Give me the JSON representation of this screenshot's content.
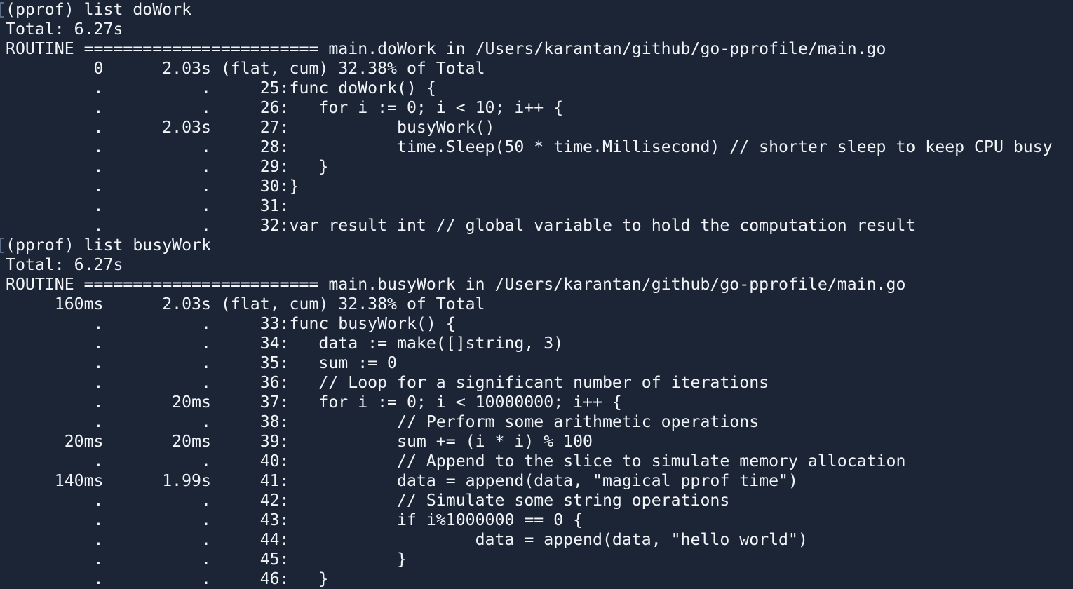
{
  "terminal": {
    "background": "#1b2536",
    "foreground": "#f2f4f8",
    "lines": [
      {
        "text": "(pprof) list doWork",
        "prompt": true
      },
      {
        "text": "Total: 6.27s"
      },
      {
        "text": "ROUTINE ======================== main.doWork in /Users/karantan/github/go-pprofile/main.go"
      },
      {
        "text": "         0      2.03s (flat, cum) 32.38% of Total"
      },
      {
        "text": "         .          .     25:func doWork() {"
      },
      {
        "text": "         .          .     26:   for i := 0; i < 10; i++ {"
      },
      {
        "text": "         .      2.03s     27:           busyWork()"
      },
      {
        "text": "         .          .     28:           time.Sleep(50 * time.Millisecond) // shorter sleep to keep CPU busy"
      },
      {
        "text": "         .          .     29:   }"
      },
      {
        "text": "         .          .     30:}"
      },
      {
        "text": "         .          .     31:"
      },
      {
        "text": "         .          .     32:var result int // global variable to hold the computation result"
      },
      {
        "text": "(pprof) list busyWork",
        "prompt": true
      },
      {
        "text": "Total: 6.27s"
      },
      {
        "text": "ROUTINE ======================== main.busyWork in /Users/karantan/github/go-pprofile/main.go"
      },
      {
        "text": "     160ms      2.03s (flat, cum) 32.38% of Total"
      },
      {
        "text": "         .          .     33:func busyWork() {"
      },
      {
        "text": "         .          .     34:   data := make([]string, 3)"
      },
      {
        "text": "         .          .     35:   sum := 0"
      },
      {
        "text": "         .          .     36:   // Loop for a significant number of iterations"
      },
      {
        "text": "         .       20ms     37:   for i := 0; i < 10000000; i++ {"
      },
      {
        "text": "         .          .     38:           // Perform some arithmetic operations"
      },
      {
        "text": "      20ms       20ms     39:           sum += (i * i) % 100"
      },
      {
        "text": "         .          .     40:           // Append to the slice to simulate memory allocation"
      },
      {
        "text": "     140ms      1.99s     41:           data = append(data, \"magical pprof time\")"
      },
      {
        "text": "         .          .     42:           // Simulate some string operations"
      },
      {
        "text": "         .          .     43:           if i%1000000 == 0 {"
      },
      {
        "text": "         .          .     44:                   data = append(data, \"hello world\")"
      },
      {
        "text": "         .          .     45:           }"
      },
      {
        "text": "         .          .     46:   }"
      }
    ]
  }
}
